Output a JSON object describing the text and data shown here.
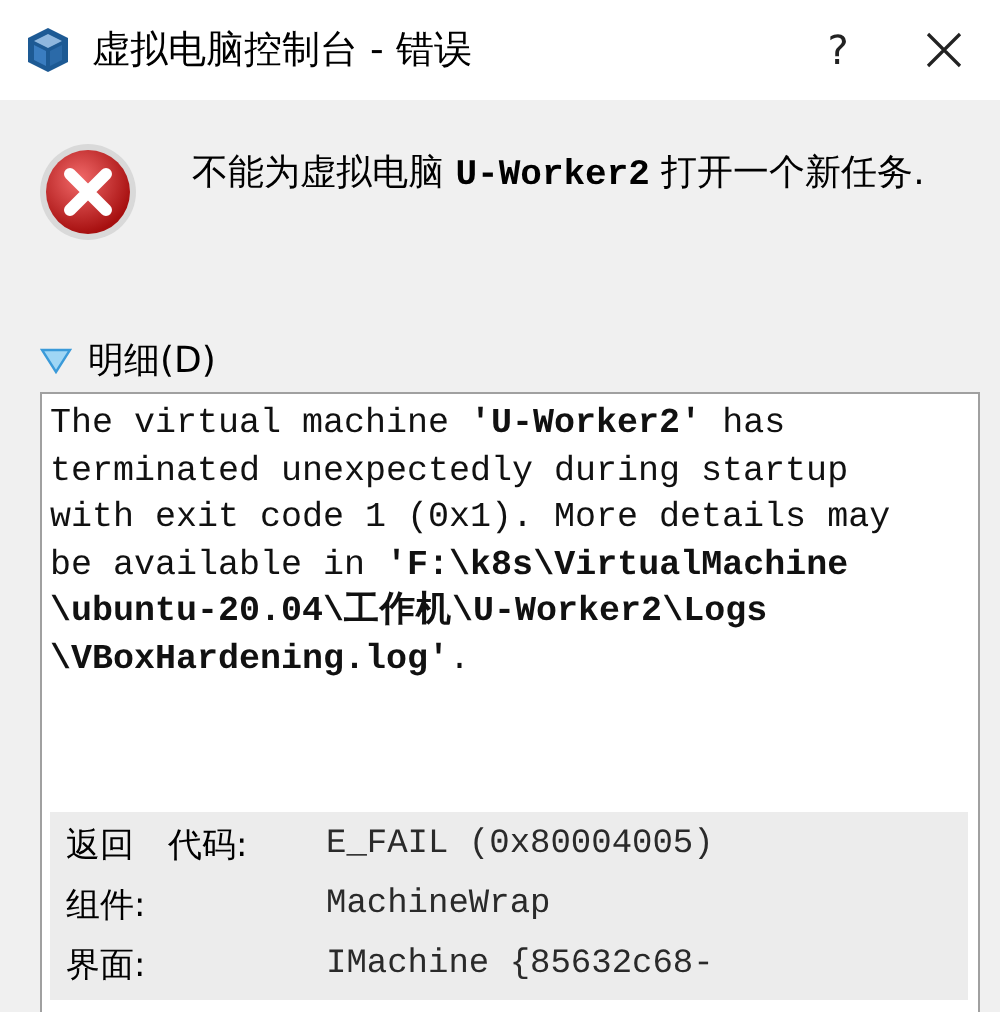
{
  "window": {
    "title": "虚拟电脑控制台 - 错误",
    "help": "?"
  },
  "message": "不能为虚拟电脑 **U-Worker2** 打开一个新任务.",
  "details": {
    "label": "明细(D)",
    "expanded": true,
    "text": "The virtual machine **'U-Worker2'** has terminated unexpectedly during startup with exit code 1 (0x1). More details may be available in **'F:\\k8s\\VirtualMachine\\ubuntu-20.04\\工作机\\U-Worker2\\Logs\\VBoxHardening.log'**.",
    "info": [
      {
        "label": "返回　代码:",
        "value": "E_FAIL (0x80004005)"
      },
      {
        "label": "组件:",
        "value": "MachineWrap"
      },
      {
        "label": "界面:",
        "value": "IMachine {85632c68-"
      }
    ]
  }
}
